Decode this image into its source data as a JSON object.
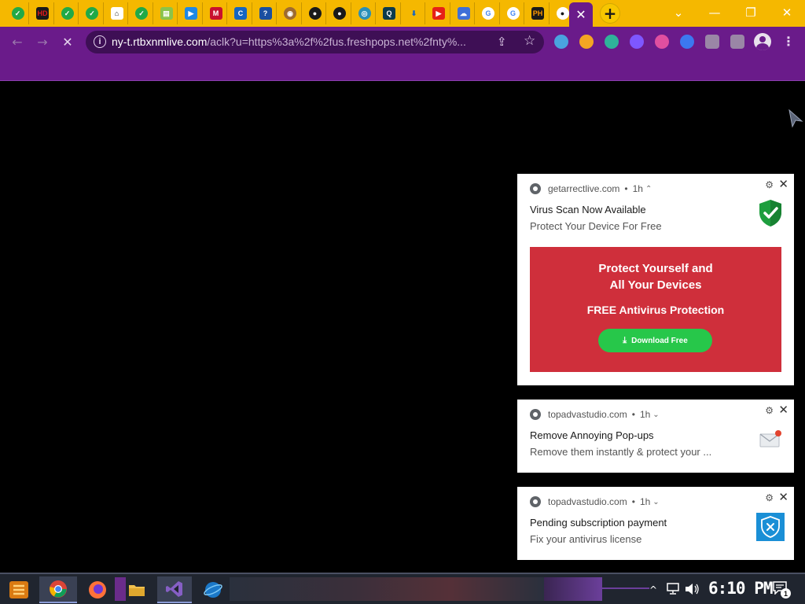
{
  "browser": {
    "tabs": [
      {
        "name": "tab-green-check-1",
        "glyph": "✓",
        "bg": "#21a947",
        "sq": false
      },
      {
        "name": "tab-hd",
        "glyph": "HD",
        "bg": "#1a1a1a",
        "fg": "#e21b1b",
        "sq": true
      },
      {
        "name": "tab-green-check-2",
        "glyph": "✓",
        "bg": "#21a947",
        "sq": false
      },
      {
        "name": "tab-green-check-3",
        "glyph": "✓",
        "bg": "#21a947",
        "sq": false
      },
      {
        "name": "tab-home",
        "glyph": "⌂",
        "bg": "#ffffff",
        "fg": "#222222",
        "sq": true
      },
      {
        "name": "tab-green-check-4",
        "glyph": "✓",
        "bg": "#21a947",
        "sq": false
      },
      {
        "name": "tab-sheets",
        "glyph": "▤",
        "bg": "#8bc34a",
        "sq": true
      },
      {
        "name": "tab-play",
        "glyph": "▶",
        "bg": "#1e88e5",
        "sq": true
      },
      {
        "name": "tab-mcafee",
        "glyph": "M",
        "bg": "#c8102e",
        "sq": true
      },
      {
        "name": "tab-c",
        "glyph": "C",
        "bg": "#1565c0",
        "sq": true
      },
      {
        "name": "tab-question",
        "glyph": "?",
        "bg": "#1a4fa0",
        "sq": true
      },
      {
        "name": "tab-globe",
        "glyph": "◉",
        "bg": "#9e6b30",
        "sq": false
      },
      {
        "name": "tab-github-1",
        "glyph": "●",
        "bg": "#1a1a1a",
        "sq": false
      },
      {
        "name": "tab-github-2",
        "glyph": "●",
        "bg": "#1a1a1a",
        "sq": false
      },
      {
        "name": "tab-earth",
        "glyph": "◎",
        "bg": "#2a8fb8",
        "sq": false
      },
      {
        "name": "tab-q",
        "glyph": "Q",
        "bg": "#0d3b4c",
        "sq": true
      },
      {
        "name": "tab-download",
        "glyph": "⬇",
        "bg": "#f5b800",
        "fg": "#1565c0",
        "sq": true
      },
      {
        "name": "tab-youtube",
        "glyph": "▶",
        "bg": "#e62117",
        "sq": true
      },
      {
        "name": "tab-cloud",
        "glyph": "☁",
        "bg": "#3f6fd8",
        "sq": true
      },
      {
        "name": "tab-google-1",
        "glyph": "G",
        "bg": "#ffffff",
        "fg": "#4285f4",
        "sq": false
      },
      {
        "name": "tab-google-2",
        "glyph": "G",
        "bg": "#ffffff",
        "fg": "#4285f4",
        "sq": false
      },
      {
        "name": "tab-ph",
        "glyph": "PH",
        "bg": "#1a1a1a",
        "fg": "#ff9900",
        "sq": true
      },
      {
        "name": "tab-dark-circle",
        "glyph": "●",
        "bg": "#ffffff",
        "fg": "#111111",
        "sq": false
      }
    ],
    "active_tab_close": "✕",
    "new_tab": "+",
    "window_buttons": {
      "dropdown": "⌄",
      "minimize": "—",
      "restore": "❐",
      "close": "✕"
    },
    "nav": {
      "back": "←",
      "forward": "→",
      "stop": "✕"
    },
    "site_info_icon": "i",
    "url_host": "ny-t.rtbxnmlive.com",
    "url_rest": "/aclk?u=https%3a%2f%2fus.freshpops.net%2fnty%...",
    "share_icon": "⇪",
    "bookmark_icon": "☆",
    "extensions": [
      {
        "name": "extension-1-icon",
        "color": "#4aa3df"
      },
      {
        "name": "extension-2-icon",
        "color": "#f4a623"
      },
      {
        "name": "extension-3-icon",
        "color": "#2fb39a"
      },
      {
        "name": "extension-4-icon",
        "color": "#7e57ff"
      },
      {
        "name": "extension-5-icon",
        "color": "#e04fa0"
      },
      {
        "name": "extension-6-icon",
        "color": "#3c78f0"
      },
      {
        "name": "extensions-puzzle-icon",
        "color": "#9a86a6"
      },
      {
        "name": "side-panel-icon",
        "color": "#9a86a6"
      }
    ],
    "menu_icon": "⋮"
  },
  "notifications": [
    {
      "site": "getarrectlive.com",
      "age": "1h",
      "chevron": "⌃",
      "title": "Virus Scan Now Available",
      "body": "Protect Your Device For Free",
      "icon": "green-shield-check-icon",
      "promo": {
        "headline": "Protect Yourself and\nAll Your Devices",
        "subline": "FREE Antivirus Protection",
        "button": "Download Free"
      }
    },
    {
      "site": "topadvastudio.com",
      "age": "1h",
      "chevron": "⌄",
      "title": "Remove Annoying Pop-ups",
      "body": "Remove them instantly & protect your ...",
      "icon": "mail-alert-icon"
    },
    {
      "site": "topadvastudio.com",
      "age": "1h",
      "chevron": "⌄",
      "title": "Pending subscription payment",
      "body": "Fix your antivirus license",
      "icon": "blue-shield-x-icon"
    }
  ],
  "notification_controls": {
    "separator": "•",
    "settings": "⚙",
    "close": "✕"
  },
  "taskbar": {
    "apps": [
      "start-button",
      "chrome-taskbar-icon",
      "firefox-taskbar-icon",
      "file-explorer-taskbar-icon",
      "visual-studio-taskbar-icon",
      "internet-explorer-taskbar-icon"
    ],
    "tray_chevron": "^",
    "clock": "6:10 PM",
    "notification_count": "1"
  },
  "colors": {
    "tabstrip": "#f5b800",
    "toolbar": "#6a1b8a",
    "promo": "#cf2f3b",
    "download_button": "#27c74a"
  }
}
